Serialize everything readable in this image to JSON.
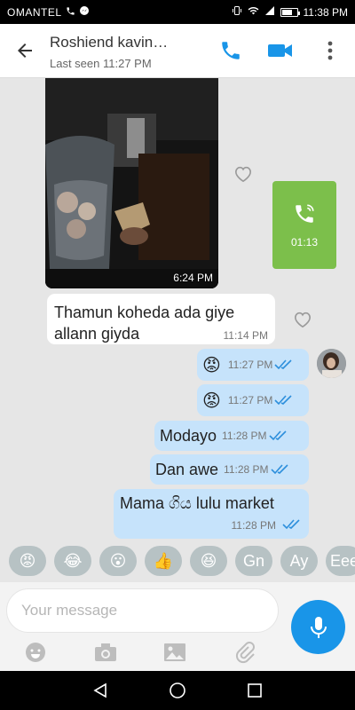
{
  "status_bar": {
    "carrier": "OMANTEL",
    "time": "11:38 PM"
  },
  "header": {
    "contact_name": "Roshiend kavin…",
    "last_seen": "Last seen 11:27 PM"
  },
  "messages": {
    "photo": {
      "time": "6:24 PM"
    },
    "call": {
      "duration": "01:13"
    },
    "incoming_text": {
      "line1": "Thamun koheda ada giye",
      "line2": "allann giyda",
      "time": "11:14 PM"
    },
    "out1": {
      "emoji": "😡",
      "time": "11:27 PM"
    },
    "out2": {
      "emoji": "😡",
      "time": "11:27 PM"
    },
    "out3": {
      "text": "Modayo",
      "time": "11:28 PM"
    },
    "out4": {
      "text": "Dan awe",
      "time": "11:28 PM"
    },
    "out5": {
      "text": "Mama ගිය lulu  market",
      "time": "11:28 PM"
    }
  },
  "quick_replies": [
    "😡",
    "😂",
    "😮",
    "👍",
    "😆",
    "Gn",
    "Ay",
    "Eee"
  ],
  "composer": {
    "placeholder": "Your message"
  },
  "icons": {
    "back": "back-arrow-icon",
    "call": "phone-icon",
    "video": "video-camera-icon",
    "menu": "more-vert-icon",
    "heart": "heart-icon",
    "mic": "microphone-icon",
    "emoji": "smiley-icon",
    "camera": "camera-icon",
    "gallery": "image-icon",
    "attach": "paperclip-icon"
  },
  "colors": {
    "accent": "#1995e8",
    "outgoing_bubble": "#c6e3fb",
    "call_card": "#7cbf4b",
    "ticks": "#2d8fdc"
  }
}
